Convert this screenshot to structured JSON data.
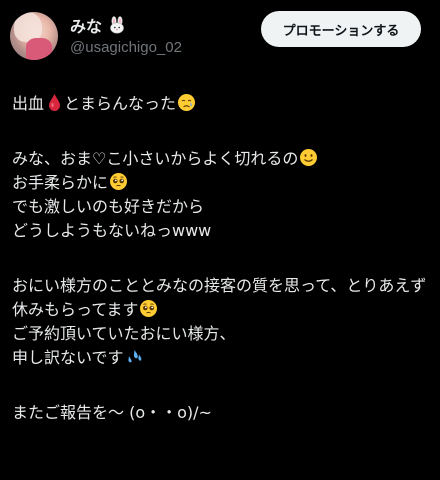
{
  "user": {
    "display_name": "みな",
    "handle": "@usagichigo_02"
  },
  "promo_button": {
    "label": "プロモーションする"
  },
  "post": {
    "line1_a": "出血",
    "line1_b": "とまらんなった",
    "line2": "みな、おま♡こ小さいからよく切れるの",
    "line3": "お手柔らかに",
    "line4": "でも激しいのも好きだから",
    "line5": "どうしようもないねっwww",
    "line6": "おにい様方のこととみなの接客の質を思って、とりあえず休みもらってます",
    "line7": "ご予約頂いていたおにい様方、",
    "line8": "申し訳ないです",
    "line9": "またご報告を〜 (o・・o)/~"
  },
  "icons": {
    "avatar": "avatar",
    "name_emoji": "rabbit-icon",
    "blood_drop": "drop-of-blood-icon",
    "crying_face": "crying-face-icon",
    "smiling_face": "slightly-smiling-face-icon",
    "pleading_face": "pleading-face-icon",
    "sweat_droplets": "sweat-droplets-icon"
  }
}
